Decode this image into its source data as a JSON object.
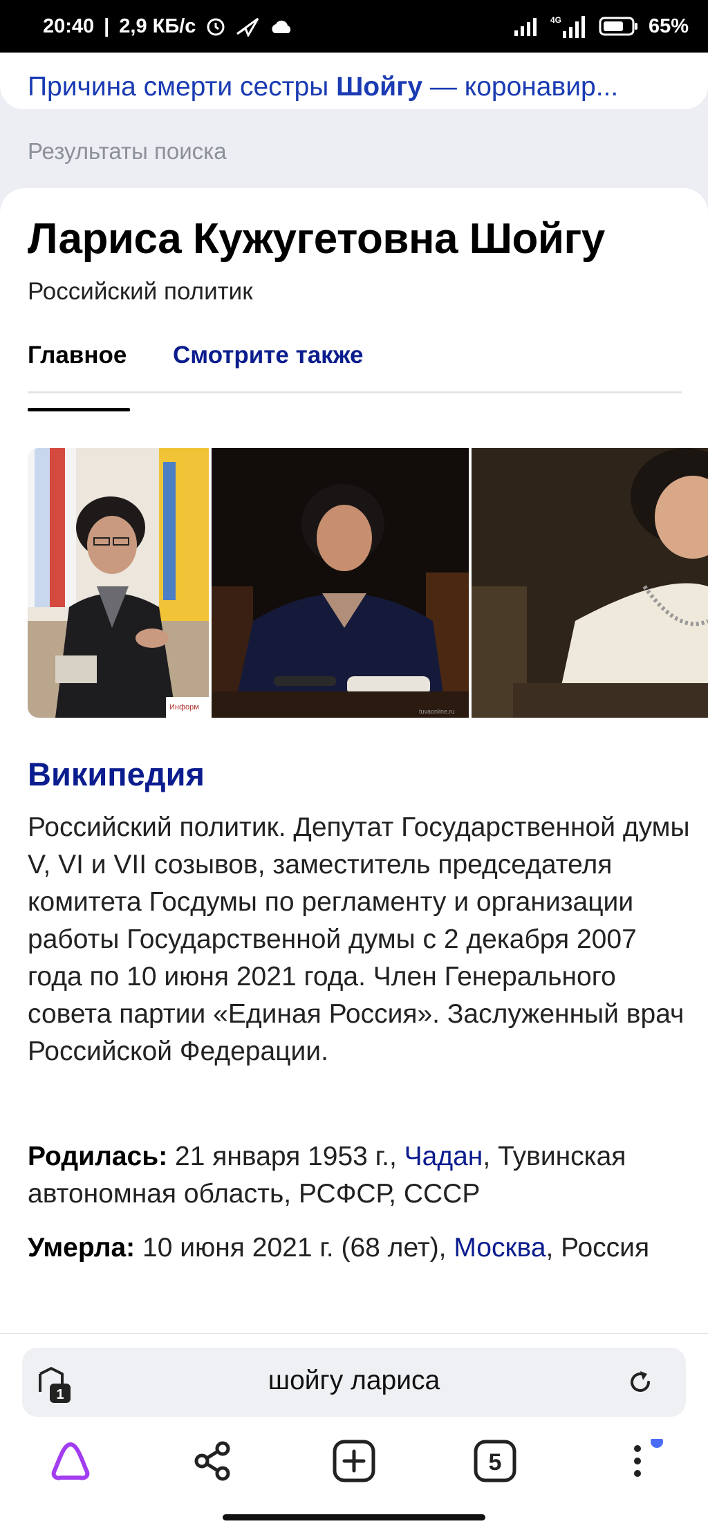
{
  "status_bar": {
    "time": "20:40",
    "speed": "2,9 КБ/с",
    "network": "4G",
    "battery": "65%"
  },
  "top_result": {
    "text_prefix": "Причина смерти сестры ",
    "text_bold": "Шойгу",
    "text_suffix": " — коронавир..."
  },
  "section_label": "Результаты поиска",
  "entity": {
    "title": "Лариса Кужугетовна Шойгу",
    "subtitle": "Российский политик",
    "tabs": [
      "Главное",
      "Смотрите также"
    ],
    "gallery_watermarks": [
      "Информ",
      "tuvaonline.ru"
    ],
    "wiki_heading": "Википедия",
    "wiki_text": "Российский политик. Депутат Государственной думы V, VI и VII созывов, заместитель председателя комитета Госдумы по регламенту и организации работы Государственной думы с 2 декабря 2007 года по 10 июня 2021 года. Член Генерального совета партии «Единая Россия». Заслуженный врач Российской Федерации.",
    "born": {
      "label": "Родилась:",
      "date": " 21 января 1953 г., ",
      "place_link": "Чадан",
      "rest": ", Тувинская автономная область, РСФСР, СССР"
    },
    "died": {
      "label": "Умерла:",
      "date": " 10 июня 2021 г. (68 лет), ",
      "place_link": "Москва",
      "rest": ", Россия"
    }
  },
  "browser": {
    "query": "шойгу лариса",
    "tabs_count": "5",
    "tab_badge": "1"
  },
  "colors": {
    "link": "#0b1d8e",
    "alice": "#a23cf0",
    "notification_dot": "#4a6cf7"
  }
}
